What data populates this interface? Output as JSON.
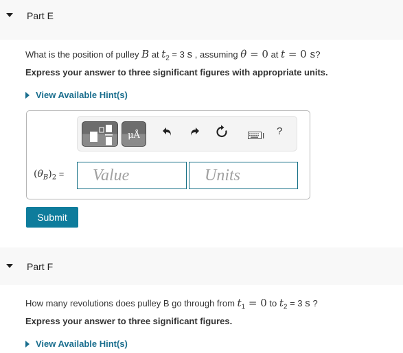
{
  "partE": {
    "title": "Part E",
    "question": {
      "prefix": "What is the position of pulley ",
      "var_B": "B",
      "at": " at ",
      "t2": "t",
      "t2_sub": "2",
      "t2_value": " = 3 ",
      "unit_s": "s",
      "assuming": " , assuming ",
      "theta": "θ",
      "eq_zero": " = 0",
      "at2": " at ",
      "t": "t",
      "eq_zero_s": " = 0 ",
      "unit_s2": "s",
      "end": "?"
    },
    "instruction": "Express your answer to three significant figures with appropriate units.",
    "hint_link": "View Available Hint(s)",
    "answer": {
      "variable_label": "(θB)2 =",
      "value_placeholder": "Value",
      "units_placeholder": "Units",
      "value": "",
      "units": ""
    },
    "toolbar": {
      "units_button_label": "μÅ",
      "help_label": "?"
    },
    "submit_label": "Submit"
  },
  "partF": {
    "title": "Part F",
    "question": {
      "prefix": "How many revolutions does pulley B go through from ",
      "t1": "t",
      "t1_sub": "1",
      "t1_value": " = 0",
      "to": " to ",
      "t2": "t",
      "t2_sub": "2",
      "t2_value": " = 3 ",
      "unit_s": "s",
      "end": " ?"
    },
    "instruction": "Express your answer to three significant figures.",
    "hint_link": "View Available Hint(s)"
  },
  "colors": {
    "accent": "#0e7c9c",
    "link": "#1a6e8e",
    "field_border": "#157086",
    "header_bg": "#f8f8f8"
  }
}
